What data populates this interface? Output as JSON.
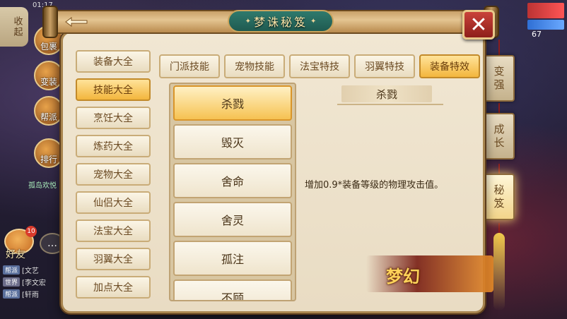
{
  "hud": {
    "collapse_label": "收起",
    "time": "01:17",
    "buttons": [
      "包裹",
      "变装",
      "帮派",
      "排行"
    ],
    "guild_label": "孤岛欢悦",
    "friend_label": "好友",
    "friend_badge": "10",
    "level": "67",
    "chat": [
      {
        "tag": "帮派",
        "text": "[文艺"
      },
      {
        "tag": "世界",
        "text": "[李文宏"
      },
      {
        "tag": "帮派",
        "text": "[轩雨"
      }
    ]
  },
  "header": {
    "title": "梦诛秘笈",
    "back_icon": "back-arrow-icon",
    "close_icon": "close-icon"
  },
  "sidebar": {
    "items": [
      {
        "label": "装备大全",
        "active": false
      },
      {
        "label": "技能大全",
        "active": true
      },
      {
        "label": "烹饪大全",
        "active": false
      },
      {
        "label": "炼药大全",
        "active": false
      },
      {
        "label": "宠物大全",
        "active": false
      },
      {
        "label": "仙侣大全",
        "active": false
      },
      {
        "label": "法宝大全",
        "active": false
      },
      {
        "label": "羽翼大全",
        "active": false
      },
      {
        "label": "加点大全",
        "active": false
      }
    ]
  },
  "tabs": [
    {
      "label": "门派技能",
      "active": false
    },
    {
      "label": "宠物技能",
      "active": false
    },
    {
      "label": "法宝特技",
      "active": false
    },
    {
      "label": "羽翼特技",
      "active": false
    },
    {
      "label": "装备特效",
      "active": true
    }
  ],
  "skills": [
    {
      "label": "杀戮",
      "active": true
    },
    {
      "label": "毁灭",
      "active": false
    },
    {
      "label": "舍命",
      "active": false
    },
    {
      "label": "舍灵",
      "active": false
    },
    {
      "label": "孤注",
      "active": false
    },
    {
      "label": "不顾",
      "active": false
    }
  ],
  "detail": {
    "title": "杀戮",
    "description": "增加0.9*装备等级的物理攻击值。"
  },
  "right_tags": [
    {
      "chars": [
        "变",
        "强"
      ],
      "active": false
    },
    {
      "chars": [
        "成",
        "长"
      ],
      "active": false
    },
    {
      "chars": [
        "秘",
        "笈"
      ],
      "active": true
    }
  ],
  "brand": {
    "text": "梦幻"
  },
  "colors": {
    "panel_bg": "#efe4cf",
    "active_gold": "#f3b63d",
    "title_plate": "#2f7a6d",
    "close_red": "#c9433a"
  }
}
